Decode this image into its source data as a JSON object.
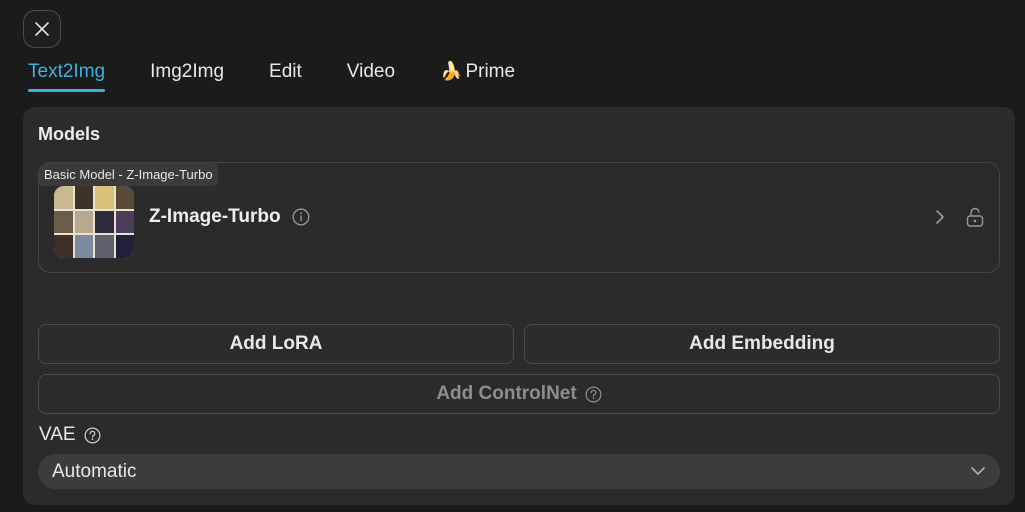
{
  "tabs": [
    {
      "label": "Text2Img",
      "active": true
    },
    {
      "label": "Img2Img",
      "active": false
    },
    {
      "label": "Edit",
      "active": false
    },
    {
      "label": "Video",
      "active": false
    },
    {
      "label": "Prime",
      "active": false,
      "emoji": "🍌"
    }
  ],
  "panel": {
    "title": "Models",
    "model": {
      "badge": "Basic Model - Z-Image-Turbo",
      "name": "Z-Image-Turbo"
    },
    "buttons": {
      "add_lora": "Add LoRA",
      "add_embedding": "Add Embedding",
      "add_controlnet": "Add ControlNet"
    },
    "vae": {
      "label": "VAE",
      "selected": "Automatic"
    }
  },
  "icons": {
    "close": "close-icon",
    "info": "info-icon",
    "help": "help-icon",
    "chevron_right": "chevron-right-icon",
    "lock": "unlock-icon",
    "chevron_down": "chevron-down-icon"
  },
  "colors": {
    "accent": "#3fb1dd",
    "background": "#1b1b1b",
    "panel": "#2b2b2b"
  }
}
